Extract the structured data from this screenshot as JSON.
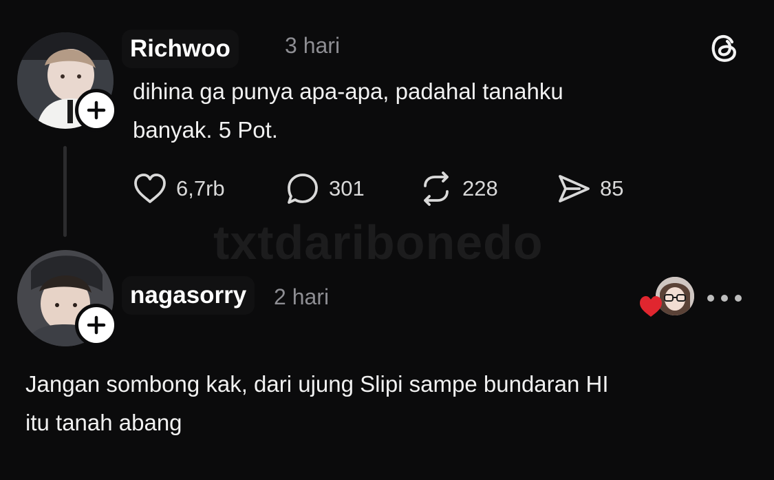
{
  "post": {
    "username": "Richwoo",
    "time": "3 hari",
    "text_line1": "dihina ga punya apa-apa, padahal tanahku",
    "text_line2": "banyak. 5 Pot.",
    "likes": "6,7rb",
    "replies": "301",
    "reposts": "228",
    "shares": "85"
  },
  "reply": {
    "username": "nagasorry",
    "time": "2 hari",
    "text_line1": "Jangan sombong kak, dari ujung Slipi sampe bundaran HI",
    "text_line2": "itu tanah abang"
  },
  "watermark": "txtdaribonedo",
  "icons": {
    "like": "heart-icon",
    "reply": "comment-icon",
    "repost": "repost-icon",
    "share": "send-icon",
    "logo": "threads-logo-icon",
    "follow": "plus-icon",
    "more": "more-icon"
  },
  "colors": {
    "background": "#0b0b0c",
    "text": "#f1f1f1",
    "muted": "#8e8e93",
    "heart": "#e0262f"
  }
}
